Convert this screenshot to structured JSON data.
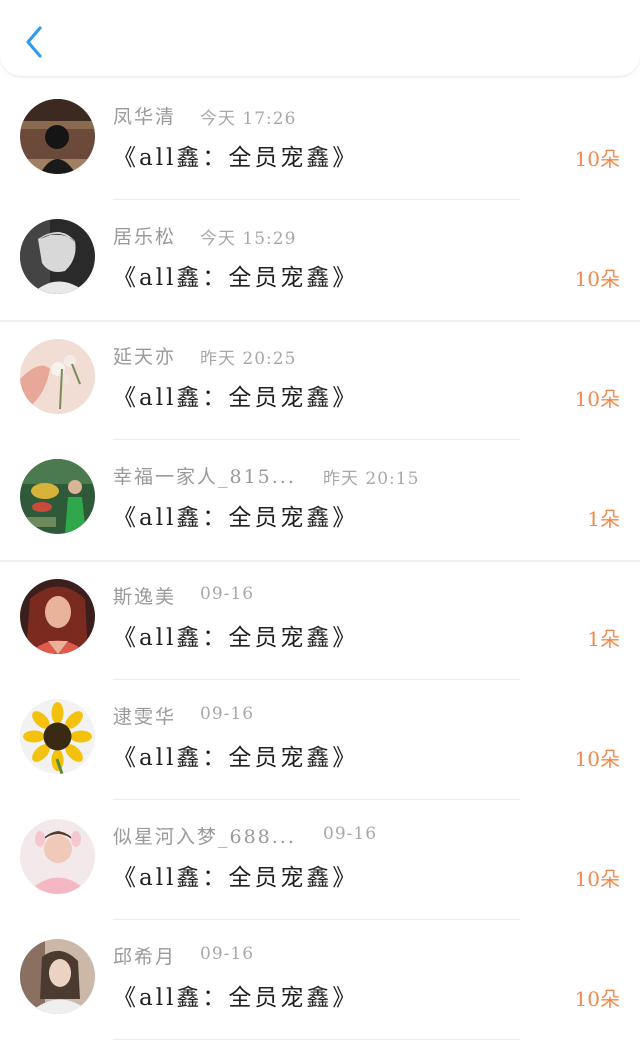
{
  "header": {
    "back_icon": "chevron-left-icon",
    "accent_color": "#2f9cf0"
  },
  "gift_count_color": "#f08a4b",
  "items": [
    {
      "name": "凤华清",
      "time": "今天 17:26",
      "title": "《all鑫：全员宠鑫》",
      "count": "10朵"
    },
    {
      "name": "居乐松",
      "time": "今天 15:29",
      "title": "《all鑫：全员宠鑫》",
      "count": "10朵"
    },
    {
      "name": "延天亦",
      "time": "昨天 20:25",
      "title": "《all鑫：全员宠鑫》",
      "count": "10朵"
    },
    {
      "name": "幸福一家人_815...",
      "time": "昨天 20:15",
      "title": "《all鑫：全员宠鑫》",
      "count": "1朵"
    },
    {
      "name": "斯逸美",
      "time": "09-16",
      "title": "《all鑫：全员宠鑫》",
      "count": "1朵"
    },
    {
      "name": "逮雯华",
      "time": "09-16",
      "title": "《all鑫：全员宠鑫》",
      "count": "10朵"
    },
    {
      "name": "似星河入梦_688...",
      "time": "09-16",
      "title": "《all鑫：全员宠鑫》",
      "count": "10朵"
    },
    {
      "name": "邱希月",
      "time": "09-16",
      "title": "《all鑫：全员宠鑫》",
      "count": "10朵"
    }
  ]
}
